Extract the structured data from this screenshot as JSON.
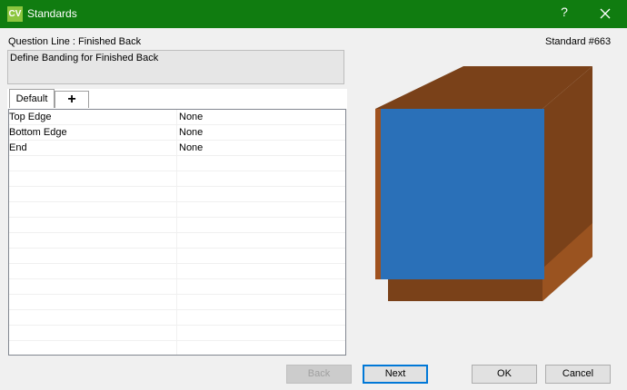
{
  "window": {
    "app_icon_text": "CV",
    "title": "Standards",
    "help_label": "?",
    "close_icon": "close-icon"
  },
  "header": {
    "question_line": "Question Line : Finished Back",
    "standard": "Standard #663"
  },
  "description": "Define Banding for Finished Back",
  "tabs": [
    {
      "label": "Default",
      "selected": true
    },
    {
      "label": "+",
      "icon": "plus-icon"
    }
  ],
  "grid": {
    "rows": [
      {
        "name": "Top Edge",
        "value": "None"
      },
      {
        "name": "Bottom Edge",
        "value": "None"
      },
      {
        "name": "End",
        "value": "None"
      },
      {
        "name": "",
        "value": ""
      },
      {
        "name": "",
        "value": ""
      },
      {
        "name": "",
        "value": ""
      },
      {
        "name": "",
        "value": ""
      },
      {
        "name": "",
        "value": ""
      },
      {
        "name": "",
        "value": ""
      },
      {
        "name": "",
        "value": ""
      },
      {
        "name": "",
        "value": ""
      },
      {
        "name": "",
        "value": ""
      },
      {
        "name": "",
        "value": ""
      },
      {
        "name": "",
        "value": ""
      },
      {
        "name": "",
        "value": ""
      },
      {
        "name": "",
        "value": ""
      }
    ]
  },
  "buttons": {
    "back": "Back",
    "next": "Next",
    "ok": "OK",
    "cancel": "Cancel"
  },
  "colors": {
    "titlebar": "#107c10",
    "panel_front": "#2a70b8",
    "wood": "#7a4119"
  }
}
